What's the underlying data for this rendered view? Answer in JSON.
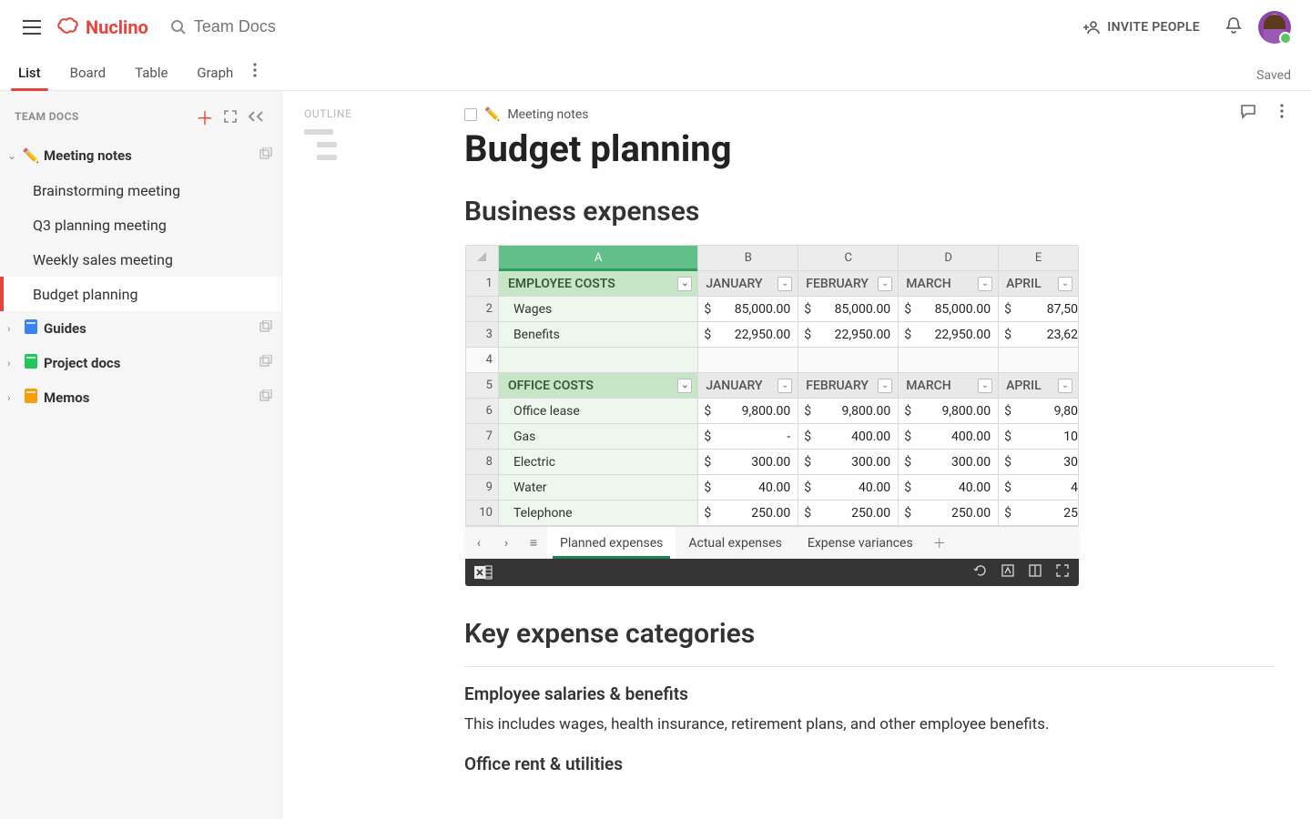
{
  "header": {
    "brand": "Nuclino",
    "search_placeholder": "Team Docs",
    "invite": "INVITE PEOPLE",
    "saved": "Saved"
  },
  "views": {
    "tabs": [
      "List",
      "Board",
      "Table",
      "Graph"
    ],
    "active": 0
  },
  "sidebar": {
    "title": "TEAM DOCS",
    "tree": [
      {
        "label": "Meeting notes",
        "icon": "✏️",
        "expanded": true,
        "children": [
          {
            "label": "Brainstorming meeting"
          },
          {
            "label": "Q3 planning meeting"
          },
          {
            "label": "Weekly sales meeting"
          },
          {
            "label": "Budget planning",
            "active": true
          }
        ]
      },
      {
        "label": "Guides",
        "icon": "book-blue"
      },
      {
        "label": "Project docs",
        "icon": "book-green"
      },
      {
        "label": "Memos",
        "icon": "book-orange"
      }
    ]
  },
  "outline_label": "OUTLINE",
  "doc": {
    "breadcrumb": {
      "icon": "✏️",
      "label": "Meeting notes"
    },
    "title": "Budget planning",
    "section1": "Business expenses",
    "section2": "Key expense categories",
    "sub1": "Employee salaries & benefits",
    "p1": "This includes wages, health insurance, retirement plans, and other employee benefits.",
    "sub2": "Office rent & utilities"
  },
  "spreadsheet": {
    "cols": [
      "A",
      "B",
      "C",
      "D",
      "E"
    ],
    "months": [
      "JANUARY",
      "FEBRUARY",
      "MARCH",
      "APRIL"
    ],
    "groups": [
      {
        "title": "EMPLOYEE COSTS",
        "rows": [
          {
            "label": "Wages",
            "b": "85,000.00",
            "c": "85,000.00",
            "d": "85,000.00",
            "e": "87,50"
          },
          {
            "label": "Benefits",
            "b": "22,950.00",
            "c": "22,950.00",
            "d": "22,950.00",
            "e": "23,62"
          }
        ]
      },
      {
        "title": "OFFICE COSTS",
        "rows": [
          {
            "label": "Office lease",
            "b": "9,800.00",
            "c": "9,800.00",
            "d": "9,800.00",
            "e": "9,80"
          },
          {
            "label": "Gas",
            "b": "-",
            "c": "400.00",
            "d": "400.00",
            "e": "10"
          },
          {
            "label": "Electric",
            "b": "300.00",
            "c": "300.00",
            "d": "300.00",
            "e": "30"
          },
          {
            "label": "Water",
            "b": "40.00",
            "c": "40.00",
            "d": "40.00",
            "e": "4"
          },
          {
            "label": "Telephone",
            "b": "250.00",
            "c": "250.00",
            "d": "250.00",
            "e": "25"
          }
        ]
      }
    ],
    "rownums": [
      "1",
      "2",
      "3",
      "4",
      "5",
      "6",
      "7",
      "8",
      "9",
      "10"
    ],
    "tabs": [
      "Planned expenses",
      "Actual expenses",
      "Expense variances"
    ],
    "active_tab": 0,
    "currency": "$"
  }
}
